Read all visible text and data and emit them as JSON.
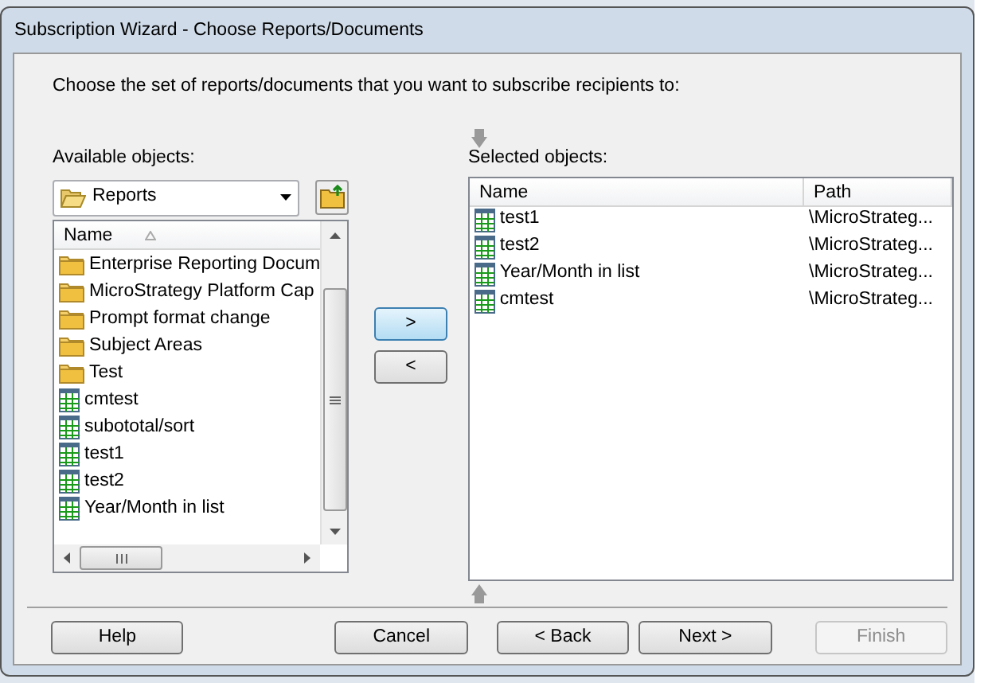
{
  "window": {
    "title": "Subscription Wizard - Choose Reports/Documents"
  },
  "instruction": "Choose the set of reports/documents that you want to subscribe recipients to:",
  "available": {
    "label": "Available objects:",
    "folder": "Reports",
    "columns": [
      "Name"
    ],
    "items": [
      {
        "name": "Enterprise Reporting Docum",
        "kind": "folder"
      },
      {
        "name": "MicroStrategy Platform Cap",
        "kind": "folder"
      },
      {
        "name": "Prompt format change",
        "kind": "folder"
      },
      {
        "name": "Subject Areas",
        "kind": "folder"
      },
      {
        "name": "Test",
        "kind": "folder"
      },
      {
        "name": "cmtest",
        "kind": "report"
      },
      {
        "name": "subototal/sort",
        "kind": "report"
      },
      {
        "name": "test1",
        "kind": "report"
      },
      {
        "name": "test2",
        "kind": "report"
      },
      {
        "name": "Year/Month in list",
        "kind": "report"
      }
    ]
  },
  "move_buttons": [
    {
      "label": ">",
      "focused": true
    },
    {
      "label": "<",
      "focused": false
    }
  ],
  "selected": {
    "label": "Selected objects:",
    "columns": [
      "Name",
      "Path"
    ],
    "items": [
      {
        "name": "test1",
        "path": "\\MicroStrateg...",
        "kind": "report"
      },
      {
        "name": "test2",
        "path": "\\MicroStrateg...",
        "kind": "report"
      },
      {
        "name": "Year/Month in list",
        "path": "\\MicroStrateg...",
        "kind": "report"
      },
      {
        "name": "cmtest",
        "path": "\\MicroStrateg...",
        "kind": "report"
      }
    ]
  },
  "buttons": [
    {
      "label": "Help",
      "disabled": false
    },
    {
      "label": "Cancel",
      "disabled": false
    },
    {
      "label": "< Back",
      "disabled": false
    },
    {
      "label": "Next >",
      "disabled": false
    },
    {
      "label": "Finish",
      "disabled": true
    }
  ]
}
